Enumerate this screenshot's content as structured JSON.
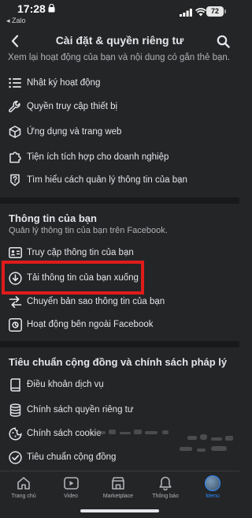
{
  "status_bar": {
    "time": "17:28",
    "back_app": "◂ Zalo",
    "battery": "72"
  },
  "header": {
    "title": "Cài đặt & quyền riêng tư"
  },
  "top_subtext": "Xem lại hoạt động của bạn và nội dung có gắn thẻ bạn.",
  "activity_items": [
    {
      "label": "Nhật ký hoạt động",
      "icon": "list-icon"
    },
    {
      "label": "Quyền truy cập thiết bị",
      "icon": "wrench-icon"
    },
    {
      "label": "Ứng dụng và trang web",
      "icon": "cube-icon"
    },
    {
      "label": "Tiện ích tích hợp cho doanh nghiệp",
      "icon": "puzzle-icon"
    },
    {
      "label": "Tìm hiểu cách quản lý thông tin của bạn",
      "icon": "question-shield-icon"
    }
  ],
  "your_info": {
    "title": "Thông tin của bạn",
    "subtitle": "Quản lý thông tin của bạn trên Facebook.",
    "items": [
      {
        "label": "Truy cập thông tin của bạn",
        "icon": "id-card-icon"
      },
      {
        "label": "Tải thông tin của bạn xuống",
        "icon": "download-icon"
      },
      {
        "label": "Chuyển bản sao thông tin của bạn",
        "icon": "transfer-icon"
      },
      {
        "label": "Hoạt động bên ngoài Facebook",
        "icon": "offsite-activity-icon"
      }
    ]
  },
  "policies": {
    "title": "Tiêu chuẩn cộng đồng và chính sách pháp lý",
    "items": [
      {
        "label": "Điều khoản dịch vụ",
        "icon": "book-icon"
      },
      {
        "label": "Chính sách quyền riêng tư",
        "icon": "database-icon"
      },
      {
        "label": "Chính sách cookie",
        "icon": "cookie-icon"
      },
      {
        "label": "Tiêu chuẩn cộng đồng",
        "icon": "check-circle-icon"
      }
    ]
  },
  "tabbar": [
    {
      "label": "Trang chủ",
      "icon": "home-icon",
      "active": false
    },
    {
      "label": "Video",
      "icon": "video-icon",
      "active": false
    },
    {
      "label": "Marketplace",
      "icon": "marketplace-icon",
      "active": false
    },
    {
      "label": "Thông báo",
      "icon": "bell-icon",
      "active": false
    },
    {
      "label": "Menu",
      "icon": "avatar",
      "active": true
    }
  ],
  "colors": {
    "background": "#242526",
    "divider": "#18191a",
    "highlight": "#e01b1b",
    "active_tab": "#2d88ff"
  }
}
